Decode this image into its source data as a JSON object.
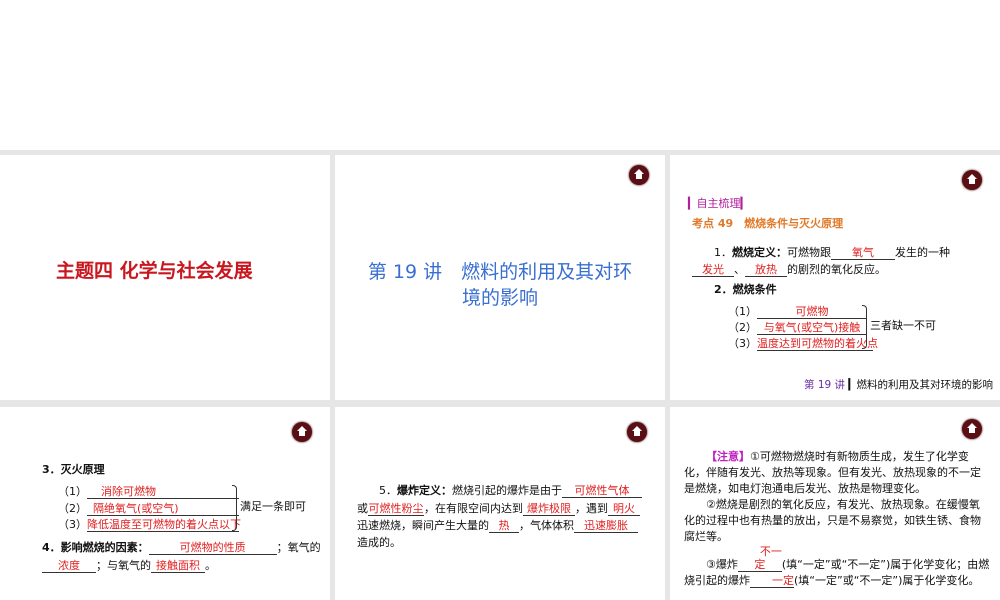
{
  "slide1": {
    "title": "主题四  化学与社会发展"
  },
  "slide2": {
    "title_line1": "第 19 讲　燃料的利用及其对环",
    "title_line2": "境的影响"
  },
  "slide3": {
    "section": "▎自主梳理▎",
    "topic": "考点 49　燃烧条件与灭火原理",
    "def_num": "1．",
    "def_label": "燃烧定义：",
    "def_text1": "可燃物跟",
    "blank_oxygen": "氧气",
    "def_text2": "发生的一种",
    "blank_light": "发光",
    "sep": "、",
    "blank_heat": "放热",
    "def_text3": "的剧烈的氧化反应。",
    "cond_title": "2．燃烧条件",
    "conds": [
      {
        "n": "（1）",
        "v": "可燃物"
      },
      {
        "n": "（2）",
        "v": "与氧气(或空气)接触"
      },
      {
        "n": "（3）",
        "v": "温度达到可燃物的着火点"
      }
    ],
    "cond_note": "三者缺一不可",
    "footer_num": "第 19 讲",
    "footer_text": "燃料的利用及其对环境的影响"
  },
  "slide4": {
    "title": "3．灭火原理",
    "items": [
      {
        "n": "（1）",
        "v": "消除可燃物"
      },
      {
        "n": "（2）",
        "v": "隔绝氧气(或空气)"
      },
      {
        "n": "（3）",
        "v": "降低温度至可燃物的着火点以下"
      }
    ],
    "note": "满足一条即可",
    "f_label": "4．影响燃烧的因素：",
    "f1": "可燃物的性质",
    "t1": "；氧气的",
    "f2": "浓度",
    "t2": "；与氧气的",
    "f3": "接触面积",
    "t3": "。"
  },
  "slide5": {
    "num": "5．",
    "label": "爆炸定义：",
    "t1": "燃烧引起的爆炸是由于",
    "b1": "可燃性气体",
    "t2": "或",
    "b2": "可燃性粉尘",
    "t3": "，在有限空间内达到",
    "b3": "爆炸极限",
    "t4": "，遇到",
    "b4": "明火",
    "t5": "迅速燃烧，瞬间产生大量的",
    "b5": "热",
    "t6": "，气体体积",
    "b6": "迅速膨胀",
    "t7": "造成的。"
  },
  "slide6": {
    "tag": "【注意】",
    "p1": "①可燃物燃烧时有新物质生成，发生了化学变化，伴随有发光、放热等现象。但有发光、放热现象的不一定是燃烧，如电灯泡通电后发光、放热是物理变化。",
    "p2": "②燃烧是剧烈的氧化反应，有发光、放热现象。在缓慢氧化的过程中也有热量的放出，只是不易察觉，如铁生锈、食物腐烂等。",
    "p3a": "③爆炸",
    "b1": "不一定",
    "p3b": "(填“一定”或“不一定”)属于化学变化；由燃烧引起的爆炸",
    "b2": "一定",
    "p3c": "(填“一定”或“不一定”)属于化学变化。"
  }
}
